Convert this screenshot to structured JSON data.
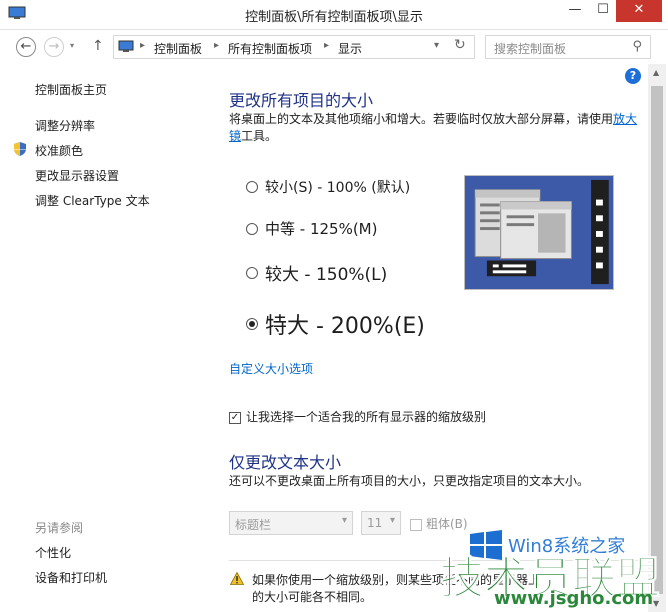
{
  "window": {
    "title": "控制面板\\所有控制面板项\\显示",
    "min_glyph": "—",
    "max_glyph": "☐",
    "close_glyph": "✕"
  },
  "nav": {
    "back_glyph": "←",
    "forward_glyph": "→",
    "dropdown_glyph": "▾",
    "up_glyph": "↑",
    "breadcrumbs": [
      "控制面板",
      "所有控制面板项",
      "显示"
    ],
    "crumb_separator": "▸",
    "refresh_glyph": "↻",
    "search_placeholder": "搜索控制面板",
    "search_glyph": "⚲"
  },
  "sidebar": {
    "items": [
      {
        "label": "控制面板主页"
      },
      {
        "label": "调整分辨率"
      },
      {
        "label": "校准颜色"
      },
      {
        "label": "更改显示器设置"
      },
      {
        "label": "调整 ClearType 文本"
      }
    ],
    "see_also_heading": "另请参阅",
    "see_also": [
      {
        "label": "个性化"
      },
      {
        "label": "设备和打印机"
      }
    ]
  },
  "main": {
    "help_glyph": "?",
    "section1": {
      "heading": "更改所有项目的大小",
      "desc_before": "将桌面上的文本及其他项缩小和增大。若要临时仅放大部分屏幕，请使用",
      "desc_link": "放大镜",
      "desc_after": "工具。"
    },
    "options": [
      {
        "label": "较小(S) - 100% (默认)",
        "checked": false
      },
      {
        "label": "中等 - 125%(M)",
        "checked": false
      },
      {
        "label": "较大 - 150%(L)",
        "checked": false
      },
      {
        "label": "特大 - 200%(E)",
        "checked": true
      }
    ],
    "custom_link": "自定义大小选项",
    "checkbox_label": "让我选择一个适合我的所有显示器的缩放级别",
    "checkbox_checked": true,
    "section2": {
      "heading": "仅更改文本大小",
      "desc": "还可以不更改桌面上所有项目的大小，只更改指定项目的文本大小。"
    },
    "item_select": "标题栏",
    "size_select": "11",
    "bold_label": "粗体(B)",
    "warning_line1": "如果你使用一个缩放级别，则某些项任不同的显示器上",
    "warning_line2": "的大小可能各不相同。"
  },
  "watermark": {
    "site_name": "Win8系统之家",
    "brand": "技术员联盟",
    "url": "www.jsgho.com"
  },
  "colors": {
    "heading": "#1e3287",
    "link": "#0066cc",
    "close_button": "#c7352c",
    "preview_bg": "#3c5aa8",
    "watermark_green": "#1a7d2a",
    "watermark_blue": "#1c6fd1"
  }
}
